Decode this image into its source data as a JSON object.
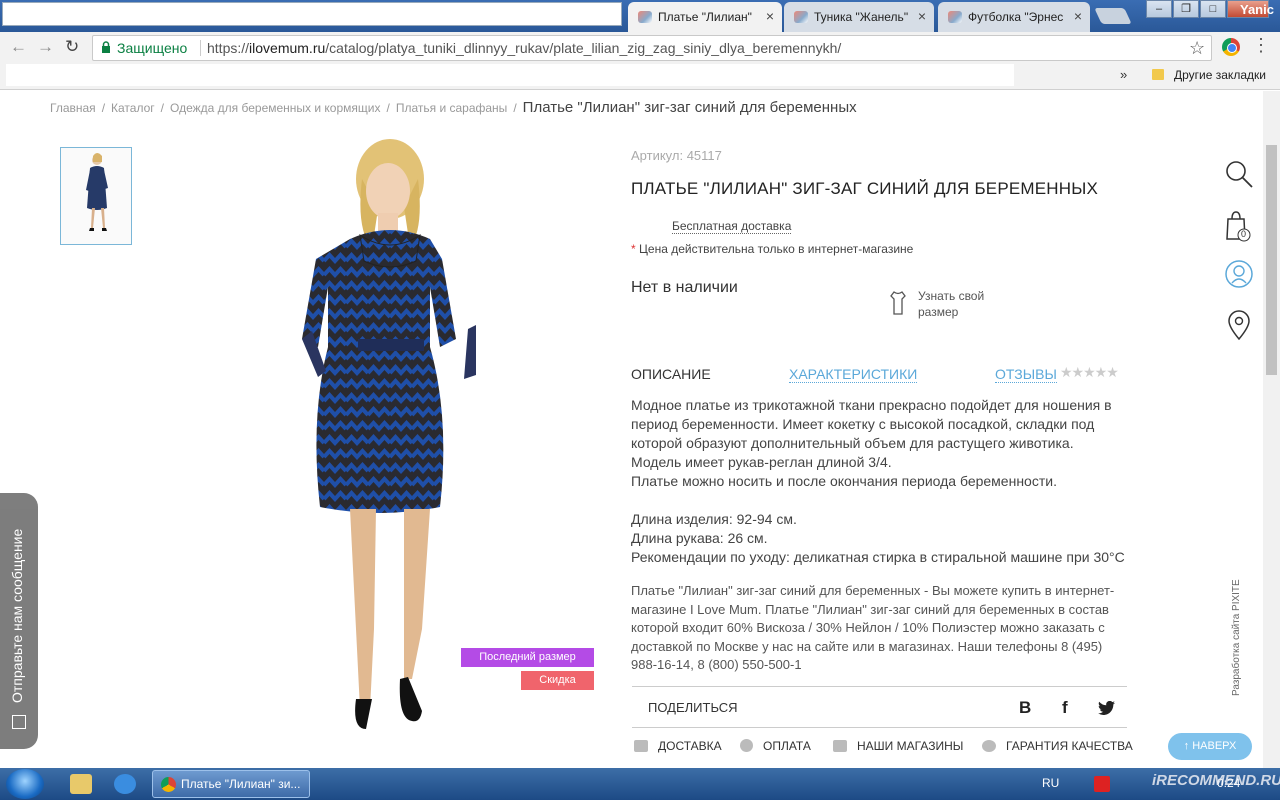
{
  "browser": {
    "tabs": [
      {
        "label": "Платье \"Лилиан\"",
        "active": true
      },
      {
        "label": "Туника \"Жанель\"",
        "active": false
      },
      {
        "label": "Футболка \"Эрнес",
        "active": false
      }
    ],
    "user_name": "Yanic",
    "secure_label": "Защищено",
    "url_scheme": "https://",
    "url_host": "ilovemum.ru",
    "url_path": "/catalog/platya_tuniki_dlinnyy_rukav/plate_lilian_zig_zag_siniy_dlya_beremennykh/",
    "bookmarks_more": "»",
    "bookmarks_folder": "Другие закладки"
  },
  "breadcrumb": {
    "items": [
      "Главная",
      "Каталог",
      "Одежда для беременных и кормящих",
      "Платья и сарафаны"
    ],
    "separator": "/",
    "current": "Платье \"Лилиан\" зиг-заг синий для беременных"
  },
  "product": {
    "sku": "Артикул: 45117",
    "title": "ПЛАТЬЕ \"ЛИЛИАН\" ЗИГ-ЗАГ СИНИЙ ДЛЯ БЕРЕМЕННЫХ",
    "delivery": "Бесплатная доставка",
    "price_note_star": "*",
    "price_note": "Цена действительна только в интернет-магазине",
    "stock": "Нет в наличии",
    "size_link": "Узнать свой размер",
    "badges": {
      "last_size": "Последний размер",
      "sale": "Скидка"
    }
  },
  "tabs": {
    "description": "ОПИСАНИЕ",
    "characteristics": "ХАРАКТЕРИСТИКИ",
    "reviews": "ОТЗЫВЫ",
    "rating_stars": "★★★★★"
  },
  "description": {
    "lines": [
      "Модное платье из трикотажной ткани  прекрасно подойдет для ношения в период беременности. Имеет кокетку с высокой посадкой, складки под которой образуют дополнительный объем для растущего животика.",
      "Модель имеет рукав-реглан длиной 3/4.",
      "Платье можно носить и после окончания периода беременности.",
      "",
      "Длина изделия: 92-94 см.",
      "Длина рукава: 26 см.",
      "Рекомендации по уходу: деликатная стирка в стиральной машине при 30°С"
    ],
    "seo_text": "Платье \"Лилиан\" зиг-заг синий для беременных - Вы можете купить в интернет-магазине I Love Mum. Платье \"Лилиан\" зиг-заг синий для беременных в состав которой входит 60% Вискоза / 30% Нейлон / 10% Полиэстер можно заказать с доставкой по Москве у нас на сайте или в магазинах. Наши телефоны 8 (495) 988-16-14, 8 (800) 550-500-1"
  },
  "share": {
    "label": "ПОДЕЛИТЬСЯ",
    "networks": [
      "В",
      "f",
      "🐦"
    ]
  },
  "info_links": [
    "ДОСТАВКА",
    "ОПЛАТА",
    "НАШИ МАГАЗИНЫ",
    "ГАРАНТИЯ КАЧЕСТВА"
  ],
  "sidebar": {
    "cart_count": "0",
    "developer": "Разработка сайта PIXITE",
    "up_button": "↑ НАВЕРХ"
  },
  "feedback": {
    "label": "Отправьте нам сообщение"
  },
  "taskbar": {
    "active_window": "Платье \"Лилиан\" зи...",
    "language": "RU",
    "clock": "0:24",
    "watermark": "iRECOMMEND.RU"
  },
  "colors": {
    "accent_blue": "#5ba8d9",
    "badge_purple": "#b44be6",
    "badge_red": "#f0646c",
    "secure_green": "#0b8043"
  }
}
